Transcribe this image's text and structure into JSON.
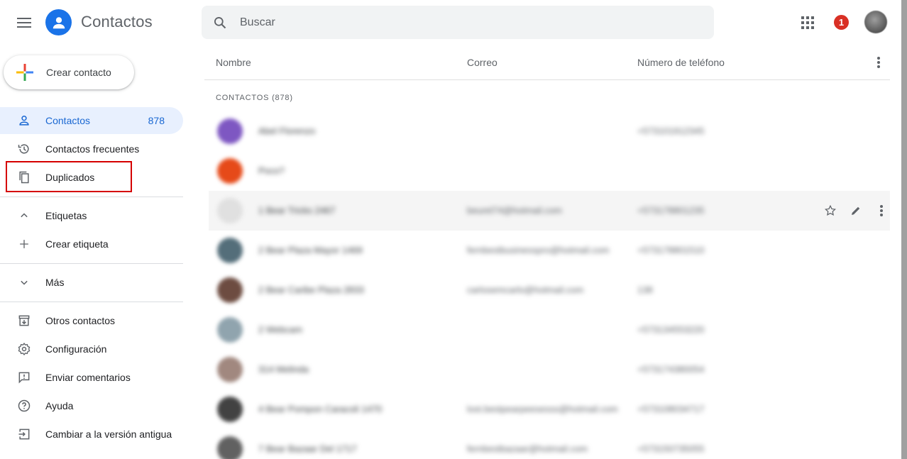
{
  "header": {
    "app_title": "Contactos",
    "search_placeholder": "Buscar",
    "notification_count": "1"
  },
  "sidebar": {
    "create_contact_label": "Crear contacto",
    "items": [
      {
        "label": "Contactos",
        "count": "878"
      },
      {
        "label": "Contactos frecuentes"
      },
      {
        "label": "Duplicados"
      },
      {
        "label": "Etiquetas"
      },
      {
        "label": "Crear etiqueta"
      },
      {
        "label": "Más"
      },
      {
        "label": "Otros contactos"
      },
      {
        "label": "Configuración"
      },
      {
        "label": "Enviar comentarios"
      },
      {
        "label": "Ayuda"
      },
      {
        "label": "Cambiar a la versión antigua"
      }
    ]
  },
  "main": {
    "columns": [
      "Nombre",
      "Correo",
      "Número de teléfono"
    ],
    "section_label": "CONTACTOS (878)",
    "rows": [
      {
        "name": "Abel Florenzo",
        "email": "",
        "phone": "+573101912345",
        "avatar_color": "#7e57c2"
      },
      {
        "name": "Poco?",
        "email": "",
        "phone": "",
        "avatar_color": "#e64a19"
      },
      {
        "name": "1 Bear Tricks 2467",
        "email": "beurel74@hotmail.com",
        "phone": "+573178801235",
        "avatar_color": "#e0e0e0"
      },
      {
        "name": "2 Bear Plaza Mayor 1469",
        "email": "fernbestbusinesspro@hotmail.com",
        "phone": "+573178801510",
        "avatar_color": "#546e7a"
      },
      {
        "name": "2 Bear Caribe Plaza 2833",
        "email": "carlosemcarlo@hotmail.com",
        "phone": "138",
        "avatar_color": "#6d4c41"
      },
      {
        "name": "2 Webcam",
        "email": "",
        "phone": "+573134553220",
        "avatar_color": "#90a4ae"
      },
      {
        "name": "314 Melinda",
        "email": "",
        "phone": "+573174380054",
        "avatar_color": "#a1887f"
      },
      {
        "name": "4 Bear Pompon Caracoli 1470",
        "email": "lost.bestpearpeesesss@hotmail.com",
        "phone": "+573108034717",
        "avatar_color": "#424242"
      },
      {
        "name": "7 Bear Bazaar Del 1717",
        "email": "fernbestbazaar@hotmail.com",
        "phone": "+573150735055",
        "avatar_color": "#616161"
      }
    ]
  },
  "colors": {
    "accent": "#1a73e8",
    "active_bg": "#e8f0fe",
    "badge": "#d93025",
    "highlight": "#d50000"
  }
}
